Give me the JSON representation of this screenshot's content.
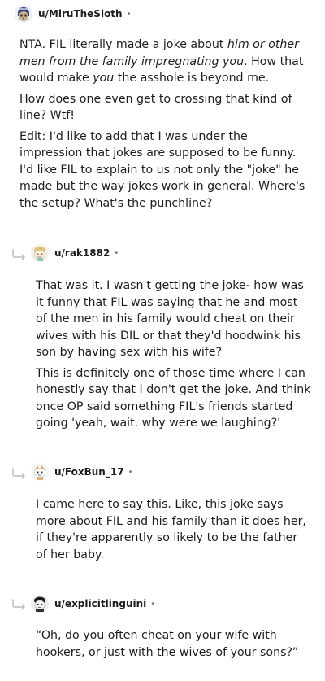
{
  "comments": [
    {
      "username": "u/MiruTheSloth",
      "dot": "•",
      "avatar": "sloth-avatar-icon",
      "p1": {
        "a": "NTA. FIL literally made a joke about ",
        "em": "him or other men from the family impregnating you",
        "b": ". How that would make ",
        "em2": "you",
        "c": " the asshole is beyond me."
      },
      "p2": "How does one even get to crossing that kind of line? Wtf!",
      "p3": "Edit: I'd like to add that I was under the impression that jokes are supposed to be funny. I'd like FIL to explain to us not only the \"joke\" he made but the way jokes work in general. Where's the setup? What's the punchline?"
    },
    {
      "username": "u/rak1882",
      "dot": "•",
      "avatar": "snoo-avatar-icon",
      "p1": "That was it. I wasn't getting the joke- how was it funny that FIL was saying that he and most of the men in his family would cheat on their wives with his DIL or that they'd hoodwink his son by having sex with his wife?",
      "p2": "This is definitely one of those time where I can honestly say that I don't get the joke. And think once OP said something FIL's friends started going 'yeah, wait. why were we laughing?'"
    },
    {
      "username": "u/FoxBun_17",
      "dot": "•",
      "avatar": "snoo-avatar-icon",
      "p1": "I came here to say this. Like, this joke says more about FIL and his family than it does her, if they're apparently so likely to be the father of her baby."
    },
    {
      "username": "u/explicitlinguini",
      "dot": "•",
      "avatar": "snoo-avatar-icon",
      "p1": "“Oh, do you often cheat on your wife with hookers, or just with the wives of your sons?”"
    }
  ]
}
